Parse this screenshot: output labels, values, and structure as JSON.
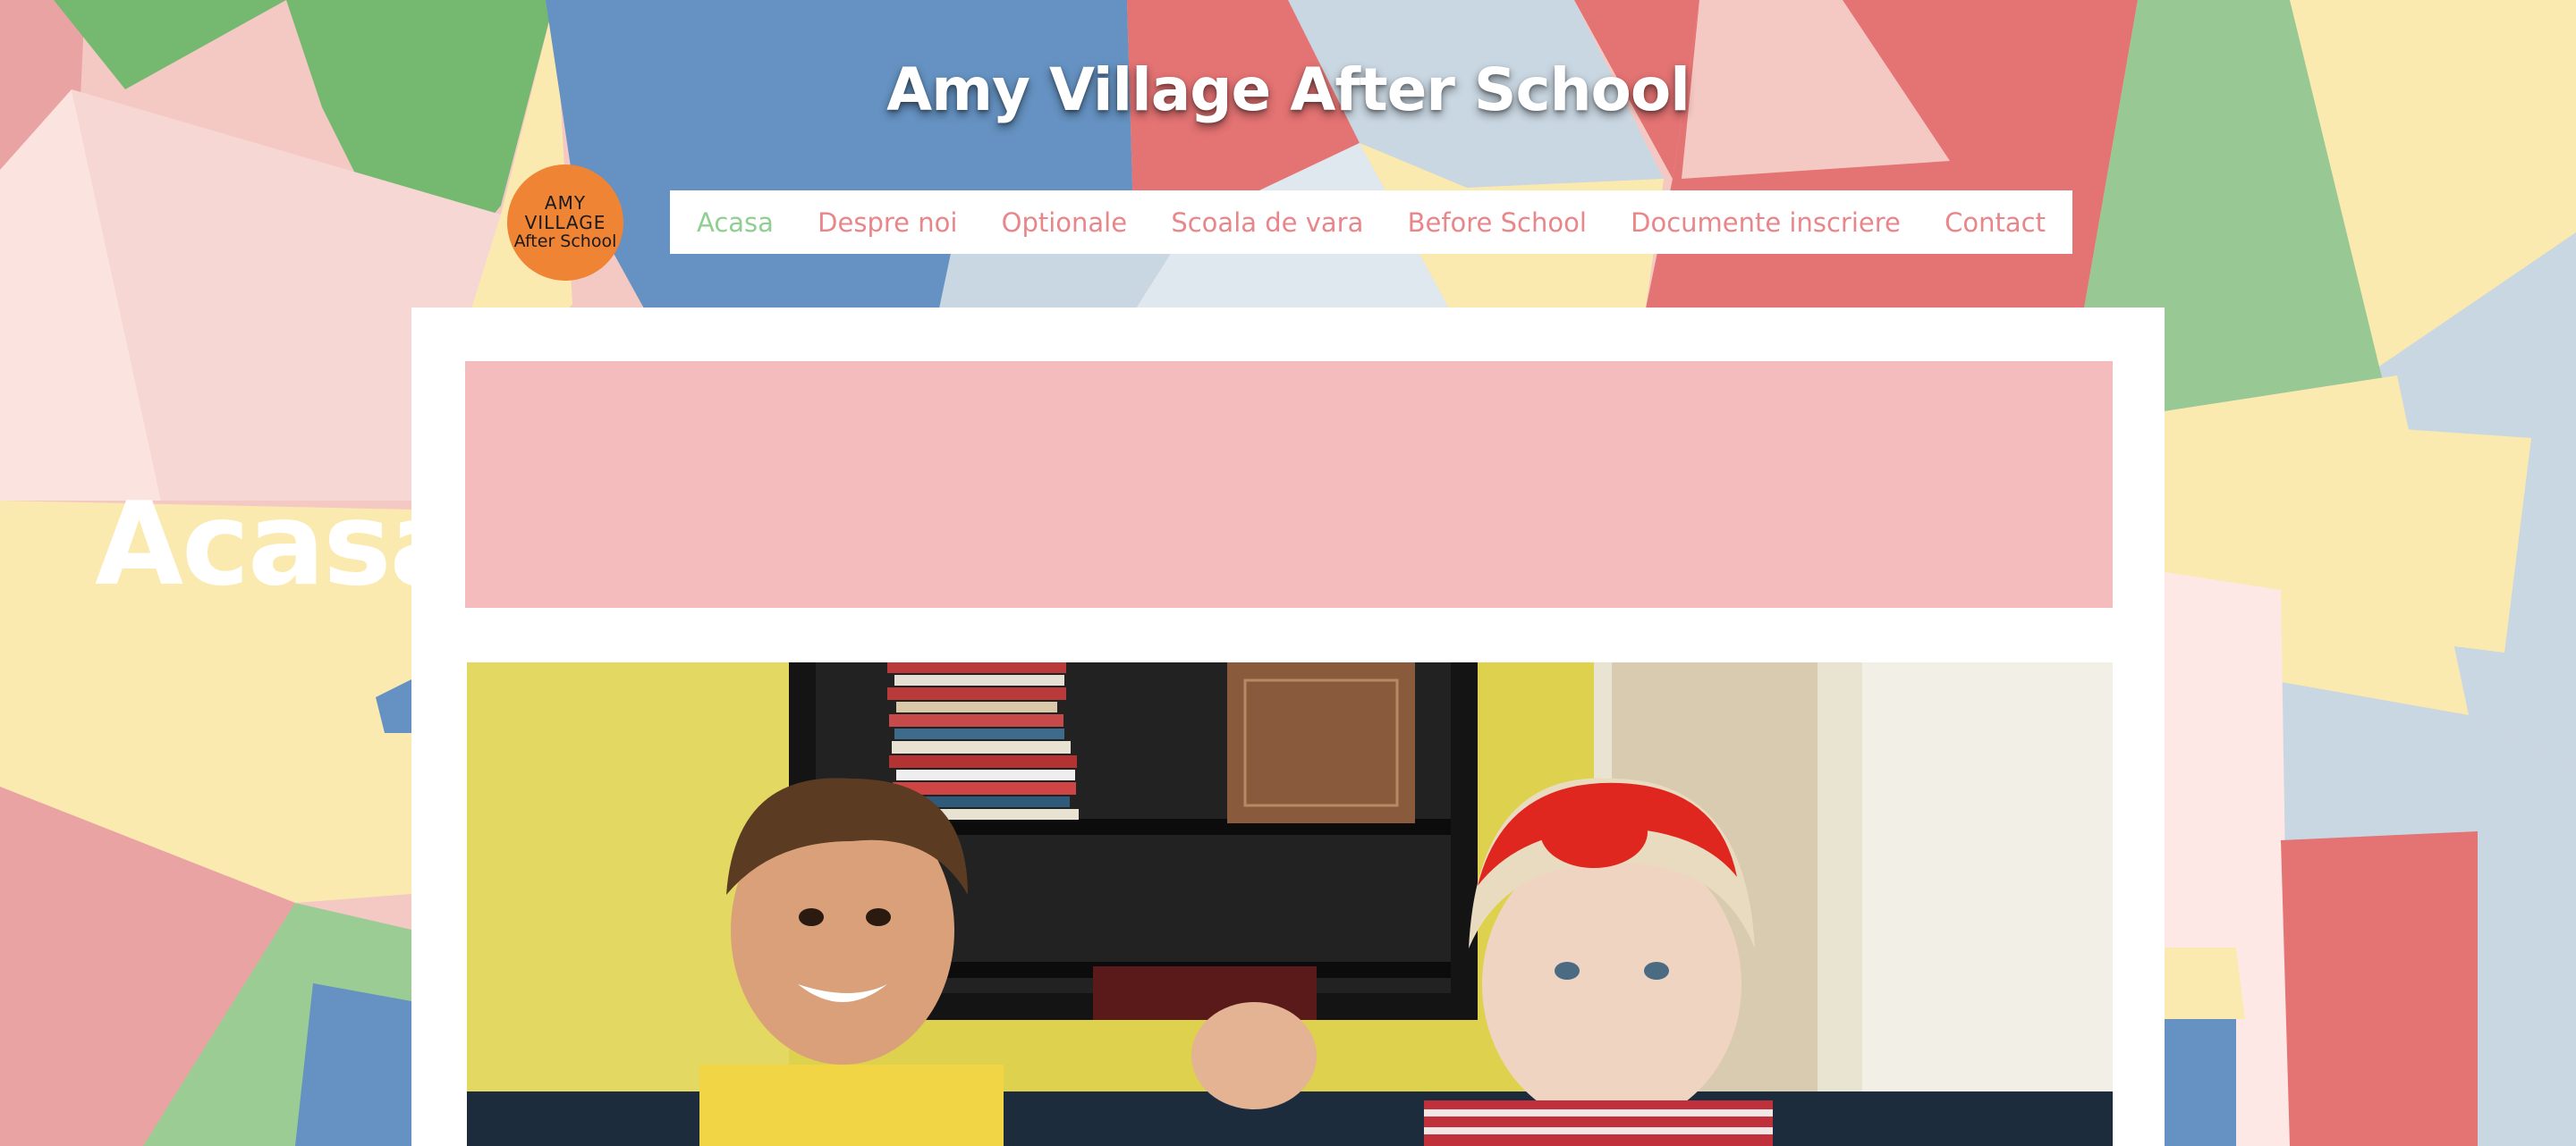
{
  "site": {
    "title": "Amy Village After School"
  },
  "logo": {
    "line1": "AMY",
    "line2": "VILLAGE",
    "line3": "After School",
    "color": "#ef8435"
  },
  "nav": {
    "items": [
      {
        "label": "Acasa",
        "active": true
      },
      {
        "label": "Despre noi",
        "active": false
      },
      {
        "label": "Optionale",
        "active": false
      },
      {
        "label": "Scoala de vara",
        "active": false
      },
      {
        "label": "Before School",
        "active": false
      },
      {
        "label": "Documente inscriere",
        "active": false
      },
      {
        "label": "Contact",
        "active": false
      }
    ],
    "active_color": "#8fcf91",
    "link_color": "#e8868a"
  },
  "page": {
    "title": "Acasa",
    "hero_color": "#f5bcbd"
  },
  "colors": {
    "green": "#75b971",
    "blue": "#6592c2",
    "red": "#e47373",
    "pink": "#f5c8c4",
    "yellow": "#fbeab0",
    "light_blue": "#c9d7e2"
  }
}
